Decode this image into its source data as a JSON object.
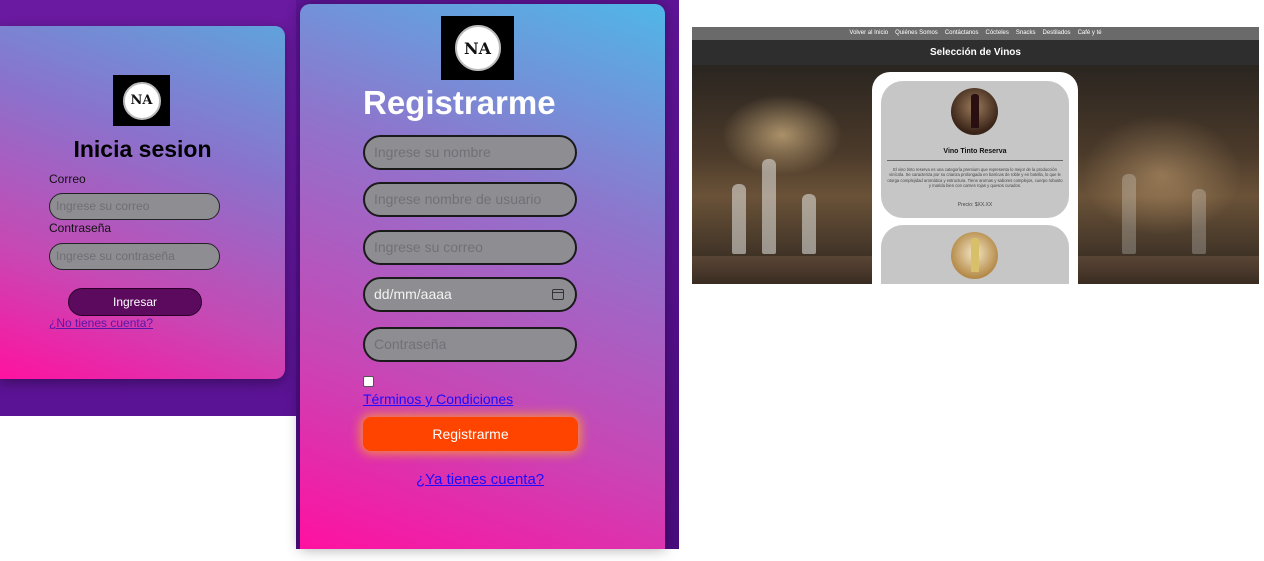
{
  "logo_text": "NA",
  "login": {
    "title": "Inicia sesion",
    "email_label": "Correo",
    "email_placeholder": "Ingrese su correo",
    "password_label": "Contraseña",
    "password_placeholder": "Ingrese su contraseña",
    "submit_label": "Ingresar",
    "register_link": "¿No tienes cuenta?"
  },
  "register": {
    "title": "Registrarme",
    "name_placeholder": "Ingrese su nombre",
    "username_placeholder": "Ingrese nombre de usuario",
    "email_placeholder": "Ingrese su correo",
    "date_value": "dd/mm/aaaa",
    "password_placeholder": "Contraseña",
    "terms_link": "Términos y Condiciones",
    "terms_checked": false,
    "submit_label": "Registrarme",
    "login_link": "¿Ya tienes cuenta?"
  },
  "wine_page": {
    "nav": [
      "Volver al Inicio",
      "Quiénes Somos",
      "Contáctanos",
      "Cócteles",
      "Snacks",
      "Destilados",
      "Café y té"
    ],
    "header": "Selección de Vinos",
    "products": [
      {
        "name": "Vino Tinto Reserva",
        "description": "El vino tinto reserva es una categoría premium que representa lo mejor de la producción vinícola. Se caracteriza por su crianza prolongada en barricas de roble y en botella, lo que le otorga complejidad aromática y estructura. Tiene aromas y sabores complejos, cuerpo robusto y marida bien con carnes rojas y quesos curados.",
        "price": "Precio: $XX.XX",
        "image": "red-wine-bottle"
      },
      {
        "image": "white-wine-glass"
      }
    ]
  },
  "colors": {
    "login_button": "#5c0a5e",
    "register_button": "#ff4400",
    "link_blue": "#1a0dff",
    "input_fill": "#8e8e92"
  }
}
